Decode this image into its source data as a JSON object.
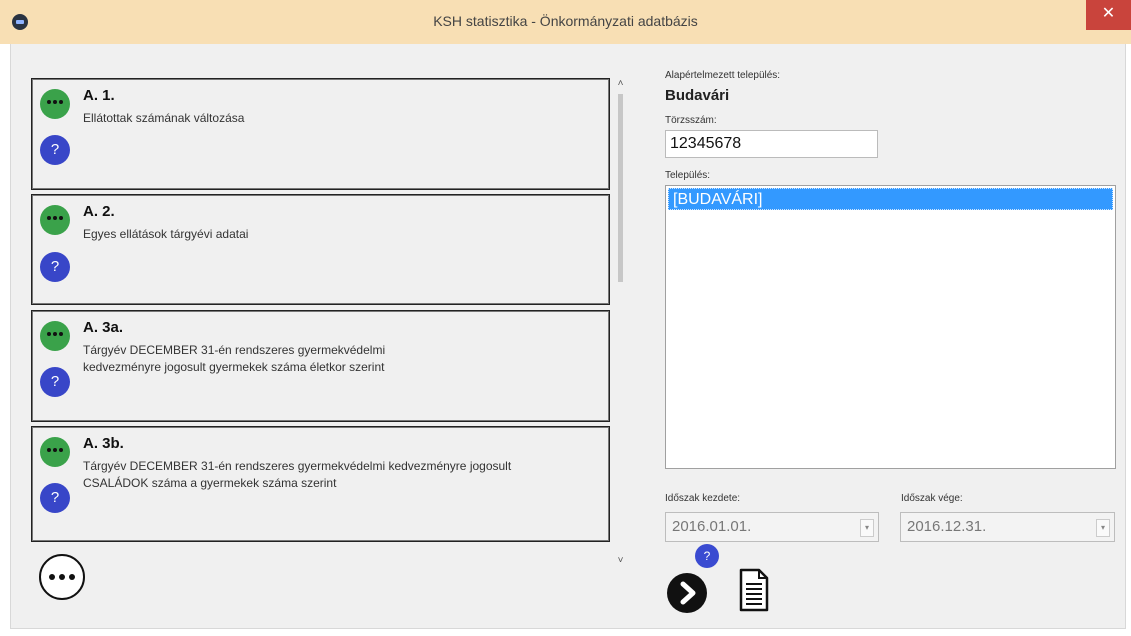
{
  "window": {
    "title": "KSH statisztika - Önkormányzati adatbázis",
    "close_glyph": "✕"
  },
  "cards": [
    {
      "code": "A. 1.",
      "description": "Ellátottak számának változása"
    },
    {
      "code": "A. 2.",
      "description": "Egyes ellátások tárgyévi adatai"
    },
    {
      "code": "A. 3a.",
      "description": "Tárgyév DECEMBER 31-én rendszeres gyermekvédelmi kedvezményre jogosult gyermekek száma életkor szerint"
    },
    {
      "code": "A. 3b.",
      "description": "Tárgyév DECEMBER 31-én rendszeres gyermekvédelmi kedvezményre jogosult CSALÁDOK száma a gyermekek száma szerint"
    }
  ],
  "help_glyph": "?",
  "scroll": {
    "up": "˄",
    "down": "˅"
  },
  "right_panel": {
    "default_muni_label": "Alapértelmezett település:",
    "default_muni_value": "Budavári",
    "tz_label": "Törzsszám:",
    "tz_value": "12345678",
    "settlement_label": "Település:",
    "settlement_items": [
      "[BUDAVÁRI]"
    ],
    "period_start_label": "Időszak kezdete:",
    "period_start_value": "2016.01.01.",
    "period_end_label": "Időszak vége:",
    "period_end_value": "2016.12.31.",
    "combo_arrow": "▾"
  },
  "icons": [
    "app-icon",
    "more-icon",
    "next-arrow-icon",
    "help-icon",
    "document-icon"
  ]
}
